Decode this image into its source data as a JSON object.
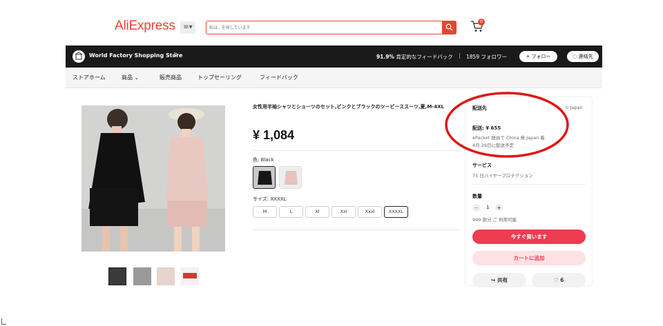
{
  "header": {
    "logo": "AliExpress",
    "menu_icon": "≡▾",
    "search_placeholder": "私は...を探しています",
    "cart_count": "0"
  },
  "store_bar": {
    "name": "World Factory Shopping Store",
    "arrow": ">",
    "feedback_percent": "91.9%",
    "feedback_label": " 肯定的なフィードバック",
    "separator": "|",
    "followers": "1859 フォロワー",
    "follow_label": "+ フォロー",
    "contact_label": "連絡先"
  },
  "nav": {
    "items": [
      "ストアホーム",
      "商品 ⌄",
      "販売商品",
      "トップセーリング",
      "フィードバック"
    ]
  },
  "product": {
    "title": "女性用半袖シャツとショーツのセット,ピンクとブラックのツーピーススーツ,夏,M-4XL",
    "price": "¥ 1,084",
    "color_label": "色: Black",
    "size_label": "サイズ: XXXXL",
    "sizes": [
      "M",
      "L",
      "Xl",
      "Xxl",
      "Xxxl",
      "XXXXL"
    ],
    "selected_size": "XXXXL"
  },
  "shipping_panel": {
    "ship_to_label": "配送先",
    "ship_to_country": "Japan",
    "shipping_cost": "配送: ¥ 655",
    "shipping_method": "ePacket 経由で China 発 Japan 着",
    "delivery_date": "4月 29日に配送予定",
    "service_label": "サービス",
    "service_detail": "75 日バイヤープロテクション",
    "quantity_label": "数量",
    "quantity_minus": "−",
    "quantity_value": "1",
    "quantity_plus": "+",
    "available": "999 部分 ご 利用可能",
    "buy_now": "今すぐ買います",
    "add_to_cart": "カートに追加",
    "share": "共有",
    "wishlist_count": "6"
  },
  "colors": {
    "brand": "#e8452c",
    "buy_button": "#ee3c50",
    "annotation": "#e01616"
  }
}
